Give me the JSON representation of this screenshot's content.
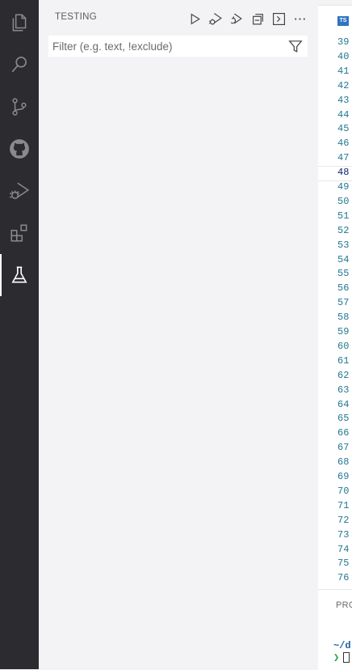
{
  "activity_bar": {
    "items": [
      {
        "icon": "files-icon"
      },
      {
        "icon": "search-icon"
      },
      {
        "icon": "source-control-icon"
      },
      {
        "icon": "github-icon"
      },
      {
        "icon": "run-debug-icon"
      },
      {
        "icon": "extensions-icon"
      },
      {
        "icon": "testing-beaker-icon",
        "active": true
      }
    ]
  },
  "sidebar": {
    "title": "TESTING",
    "toolbar": [
      {
        "icon": "run-tests-icon"
      },
      {
        "icon": "debug-tests-icon"
      },
      {
        "icon": "run-with-coverage-icon"
      },
      {
        "icon": "collapse-all-icon"
      },
      {
        "icon": "show-output-icon"
      },
      {
        "icon": "more-actions-icon"
      }
    ],
    "filter": {
      "placeholder": "Filter (e.g. text, !exclude)",
      "value": ""
    }
  },
  "editor": {
    "tab_badge": "TS",
    "line_numbers": [
      "39",
      "40",
      "41",
      "42",
      "43",
      "44",
      "45",
      "46",
      "47",
      "48",
      "49",
      "50",
      "51",
      "52",
      "53",
      "54",
      "55",
      "56",
      "57",
      "58",
      "59",
      "60",
      "61",
      "62",
      "63",
      "64",
      "65",
      "66",
      "67",
      "68",
      "69",
      "70",
      "71",
      "72",
      "73",
      "74",
      "75",
      "76"
    ],
    "current_line": "48"
  },
  "panel": {
    "tab_label": "PRO",
    "terminal_path": "~/d",
    "terminal_prompt": "❯"
  },
  "colors": {
    "activity_bar_bg": "#2c2c30",
    "sidebar_bg": "#f3f3f5",
    "line_number": "#237893",
    "ts_badge": "#2f74c0"
  }
}
